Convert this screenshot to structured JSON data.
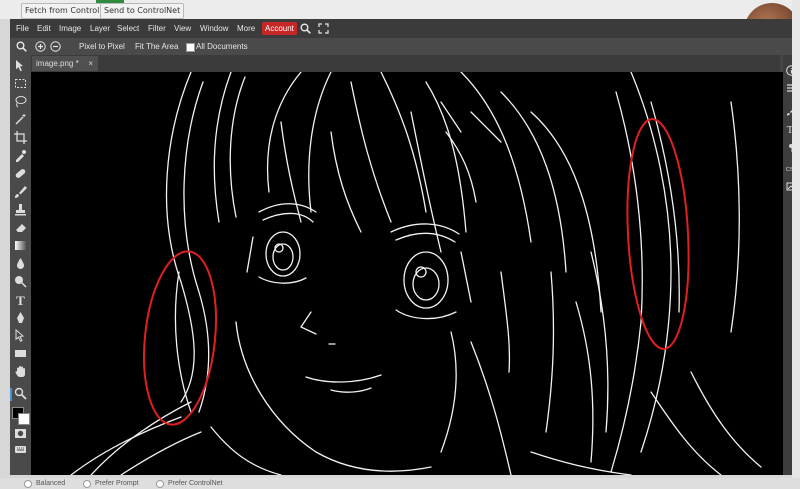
{
  "top_buttons": {
    "fetch": "Fetch from ControlNet",
    "send": "Send to ControlNet"
  },
  "menu": {
    "file": "File",
    "edit": "Edit",
    "image": "Image",
    "layer": "Layer",
    "select": "Select",
    "filter": "Filter",
    "view": "View",
    "window": "Window",
    "more": "More",
    "account": "Account"
  },
  "options": {
    "pixel_to_pixel": "Pixel to Pixel",
    "fit_area": "Fit The Area",
    "all_documents": "All Documents"
  },
  "document_tab": {
    "name": "image.png *",
    "close": "×"
  },
  "status": {
    "balanced": "Balanced",
    "prefer_prompt": "Prefer Prompt",
    "prefer_controlnet": "Prefer ControlNet"
  },
  "colors": {
    "accent": "#c62828",
    "annotation": "#e02020",
    "canvas": "#000000"
  },
  "icons": [
    "move-icon",
    "marquee-icon",
    "lasso-icon",
    "magic-wand-icon",
    "crop-icon",
    "eyedropper-icon",
    "healing-icon",
    "brush-icon",
    "stamp-icon",
    "eraser-icon",
    "gradient-icon",
    "blur-icon",
    "dodge-icon",
    "type-icon",
    "pen-icon",
    "path-select-icon",
    "shape-icon",
    "hand-icon",
    "zoom-icon"
  ]
}
